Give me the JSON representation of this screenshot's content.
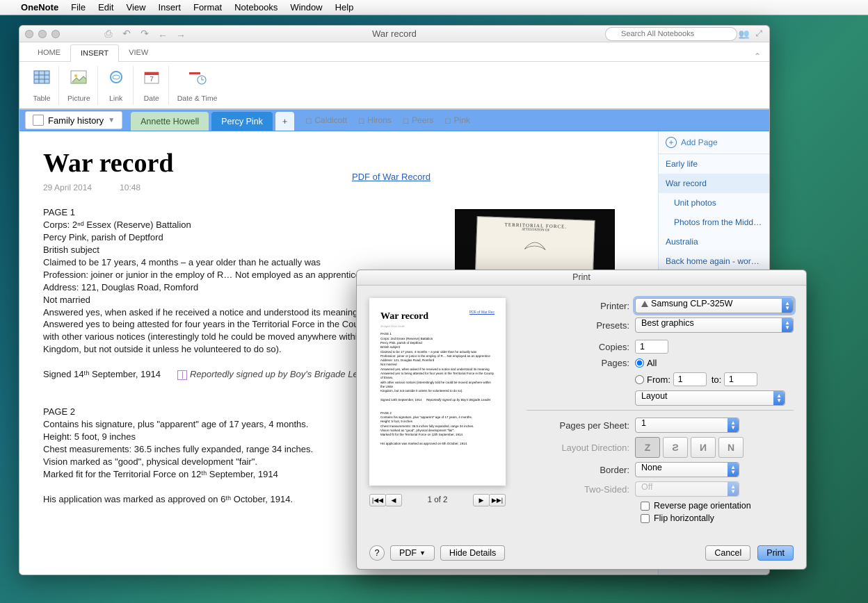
{
  "menubar": {
    "app": "OneNote",
    "items": [
      "File",
      "Edit",
      "View",
      "Insert",
      "Format",
      "Notebooks",
      "Window",
      "Help"
    ]
  },
  "window": {
    "title": "War record",
    "search_placeholder": "Search All Notebooks"
  },
  "ribbon_tabs": [
    "HOME",
    "INSERT",
    "VIEW"
  ],
  "ribbon_groups": [
    "Table",
    "Picture",
    "Link",
    "Date",
    "Date & Time"
  ],
  "notebook": "Family history",
  "section_tabs": [
    "Annette Howell",
    "Percy Pink"
  ],
  "page_links": [
    "Caldicott",
    "Hirons",
    "Peers",
    "Pink"
  ],
  "page": {
    "title": "War record",
    "date": "29 April 2014",
    "time": "10:48",
    "pdf_link": "PDF of War Record",
    "body": {
      "p1_header": "PAGE 1",
      "p1_lines": [
        "Corps: 2ⁿᵈ Essex (Reserve) Battalion",
        "Percy Pink, parish of Deptford",
        "British subject",
        "Claimed to be 17 years, 4 months – a year older than he actually was",
        "Profession: joiner or junior in the employ of R… Not employed as an apprentice",
        "Address: 121, Douglas Road, Romford",
        "Not married",
        "Answered yes, when asked if he received a notice and understood its meaning",
        "Answered yes to being attested for four years in the Territorial Force in the County",
        "with other various notices (interestingly told he could be moved anywhere within t",
        "Kingdom, but not outside it unless he volunteered to do so)."
      ],
      "signed1": "Signed 14ᵗʰ September, 1914",
      "note": "Reportedly signed up by Boy's Brigade Leader",
      "p2_header": "PAGE 2",
      "p2_lines": [
        "Contains his signature, plus \"apparent\" age of 17 years, 4 months.",
        "Height: 5 foot, 9 inches",
        "Chest measurements: 36.5 inches fully expanded, range 34 inches.",
        "Vision marked as \"good\", physical development \"fair\".",
        "Marked fit for the Territorial Force on 12ᵗʰ September, 1914"
      ],
      "approved": "His application was marked as approved on 6ᵗʰ October, 1914."
    }
  },
  "sidebar": {
    "add": "Add Page",
    "items": [
      {
        "label": "Early life",
        "indent": false
      },
      {
        "label": "War record",
        "indent": false,
        "active": true
      },
      {
        "label": "Unit photos",
        "indent": true
      },
      {
        "label": "Photos from the Middle...",
        "indent": true
      },
      {
        "label": "Australia",
        "indent": false
      },
      {
        "label": "Back home again - worki...",
        "indent": false
      }
    ]
  },
  "print": {
    "title": "Print",
    "labels": {
      "printer": "Printer:",
      "presets": "Presets:",
      "copies": "Copies:",
      "pages": "Pages:",
      "all": "All",
      "from": "From:",
      "to": "to:",
      "layout": "Layout",
      "pps": "Pages per Sheet:",
      "direction": "Layout Direction:",
      "border": "Border:",
      "twosided": "Two-Sided:",
      "reverse": "Reverse page orientation",
      "fliph": "Flip horizontally"
    },
    "printer": "Samsung CLP-325W",
    "presets": "Best graphics",
    "copies": "1",
    "from": "1",
    "to": "1",
    "pps": "1",
    "border": "None",
    "twosided": "Off",
    "pagecount": "1 of 2",
    "buttons": {
      "help": "?",
      "pdf": "PDF",
      "hide": "Hide Details",
      "cancel": "Cancel",
      "print": "Print"
    },
    "preview": {
      "title": "War record",
      "link": "PDF of War Rec",
      "meta": "29 April 2014   10:48"
    }
  }
}
